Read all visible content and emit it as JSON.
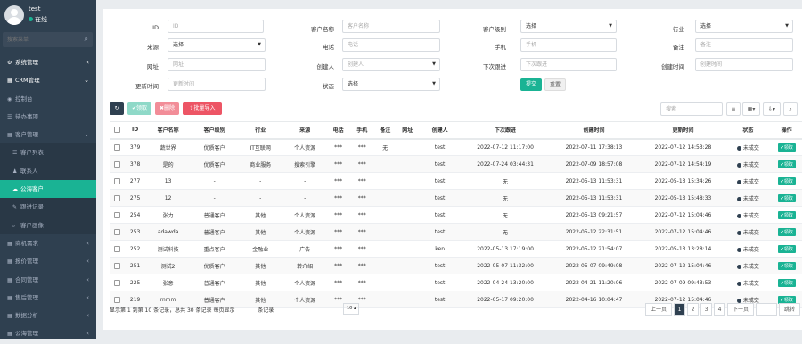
{
  "user": {
    "name": "test",
    "status": "在线"
  },
  "search": {
    "placeholder": "搜索菜单"
  },
  "menu": [
    {
      "label": "系统管理",
      "icon": "gear",
      "type": "top",
      "arrow": "‹"
    },
    {
      "label": "CRM管理",
      "icon": "grid",
      "type": "top",
      "arrow": "⌄"
    },
    {
      "label": "控制台",
      "icon": "dashboard",
      "type": "sub",
      "arrow": ""
    },
    {
      "label": "待办事项",
      "icon": "list",
      "type": "sub",
      "arrow": ""
    },
    {
      "label": "客户管理",
      "icon": "grid",
      "type": "sub",
      "arrow": "⌄"
    },
    {
      "label": "客户列表",
      "icon": "list",
      "type": "sub2",
      "arrow": ""
    },
    {
      "label": "联系人",
      "icon": "user",
      "type": "sub2",
      "arrow": ""
    },
    {
      "label": "公海客户",
      "icon": "cloud",
      "type": "active",
      "arrow": ""
    },
    {
      "label": "跟进记录",
      "icon": "chat",
      "type": "sub2",
      "arrow": ""
    },
    {
      "label": "客户画像",
      "icon": "search",
      "type": "sub2",
      "arrow": ""
    },
    {
      "label": "商机需求",
      "icon": "grid",
      "type": "sub",
      "arrow": "‹"
    },
    {
      "label": "报价管理",
      "icon": "grid",
      "type": "sub",
      "arrow": "‹"
    },
    {
      "label": "合同管理",
      "icon": "grid",
      "type": "sub",
      "arrow": "‹"
    },
    {
      "label": "售后管理",
      "icon": "grid",
      "type": "sub",
      "arrow": "‹"
    },
    {
      "label": "数据分析",
      "icon": "grid",
      "type": "sub",
      "arrow": "‹"
    },
    {
      "label": "公海管理",
      "icon": "grid",
      "type": "sub",
      "arrow": "‹"
    }
  ],
  "filters": {
    "id_label": "ID",
    "id_ph": "ID",
    "name_label": "客户名称",
    "name_ph": "客户名称",
    "level_label": "客户级别",
    "level_val": "选择",
    "industry_label": "行业",
    "industry_val": "选择",
    "source_label": "来源",
    "source_val": "选择",
    "phone_label": "电话",
    "phone_ph": "电话",
    "mobile_label": "手机",
    "mobile_ph": "手机",
    "note_label": "备注",
    "note_ph": "备注",
    "url_label": "网址",
    "url_ph": "网址",
    "creator_label": "创建人",
    "creator_ph": "创建人",
    "next_label": "下次跟进",
    "next_ph": "下次跟进",
    "created_label": "创建时间",
    "created_ph": "创建时间",
    "updated_label": "更新时间",
    "updated_ph": "更新时间",
    "state_label": "状态",
    "state_val": "选择",
    "submit": "提交",
    "reset": "重置"
  },
  "toolbar": {
    "receive": "领取",
    "delete": "删除",
    "import": "批量导入",
    "search_ph": "搜索"
  },
  "table": {
    "headers": [
      "ID",
      "客户名称",
      "客户级别",
      "行业",
      "来源",
      "电话",
      "手机",
      "备注",
      "网址",
      "创建人",
      "下次跟进",
      "创建时间",
      "更新时间",
      "状态",
      "操作"
    ],
    "rows": [
      [
        "379",
        "蔬世界",
        "优质客户",
        "IT互联网",
        "个人资源",
        "***",
        "***",
        "无",
        "",
        "test",
        "2022-07-12 11:17:00",
        "2022-07-11 17:38:13",
        "2022-07-12 14:53:28",
        "未成交",
        "领取"
      ],
      [
        "378",
        "是的",
        "优质客户",
        "商业服务",
        "搜索引擎",
        "***",
        "***",
        "",
        "",
        "test",
        "2022-07-24 03:44:31",
        "2022-07-09 18:57:08",
        "2022-07-12 14:54:19",
        "未成交",
        "领取"
      ],
      [
        "277",
        "13",
        "-",
        "-",
        "-",
        "***",
        "***",
        "",
        "",
        "test",
        "无",
        "2022-05-13 11:53:31",
        "2022-05-13 15:34:26",
        "未成交",
        "领取"
      ],
      [
        "275",
        "12",
        "-",
        "-",
        "-",
        "***",
        "***",
        "",
        "",
        "test",
        "无",
        "2022-05-13 11:53:31",
        "2022-05-13 15:48:33",
        "未成交",
        "领取"
      ],
      [
        "254",
        "张力",
        "普通客户",
        "其他",
        "个人资源",
        "***",
        "***",
        "",
        "",
        "test",
        "无",
        "2022-05-13 09:21:57",
        "2022-07-12 15:04:46",
        "未成交",
        "领取"
      ],
      [
        "253",
        "adawda",
        "普通客户",
        "其他",
        "个人资源",
        "***",
        "***",
        "",
        "",
        "test",
        "无",
        "2022-05-12 22:31:51",
        "2022-07-12 15:04:46",
        "未成交",
        "领取"
      ],
      [
        "252",
        "测试科技",
        "重点客户",
        "金融业",
        "广告",
        "***",
        "***",
        "",
        "",
        "ken",
        "2022-05-13 17:19:00",
        "2022-05-12 21:54:07",
        "2022-05-13 13:28:14",
        "未成交",
        "领取"
      ],
      [
        "251",
        "测试2",
        "优质客户",
        "其他",
        "转介绍",
        "***",
        "***",
        "",
        "",
        "test",
        "2022-05-07 11:32:00",
        "2022-05-07 09:49:08",
        "2022-07-12 15:04:46",
        "未成交",
        "领取"
      ],
      [
        "225",
        "张意",
        "普通客户",
        "其他",
        "个人资源",
        "***",
        "***",
        "",
        "",
        "test",
        "2022-04-24 13:20:00",
        "2022-04-21 11:20:06",
        "2022-07-09 09:43:53",
        "未成交",
        "领取"
      ],
      [
        "219",
        "mmm",
        "普通客户",
        "其他",
        "个人资源",
        "***",
        "***",
        "",
        "",
        "test",
        "2022-05-17 09:20:00",
        "2022-04-16 10:04:47",
        "2022-07-12 15:04:46",
        "未成交",
        "领取"
      ]
    ]
  },
  "footer": {
    "prefix": "显示第 1 到第 10 条记录，总共 30 条记录 每页显示",
    "per_page": "10",
    "suffix": "条记录"
  },
  "pager": {
    "prev": "上一页",
    "pages": [
      "1",
      "2",
      "3",
      "4"
    ],
    "next": "下一页",
    "go": "跳转"
  },
  "colors": {
    "sidebar": "#2f4050",
    "accent": "#1ab394",
    "delete": "#ed5565",
    "import": "#ed5565"
  }
}
